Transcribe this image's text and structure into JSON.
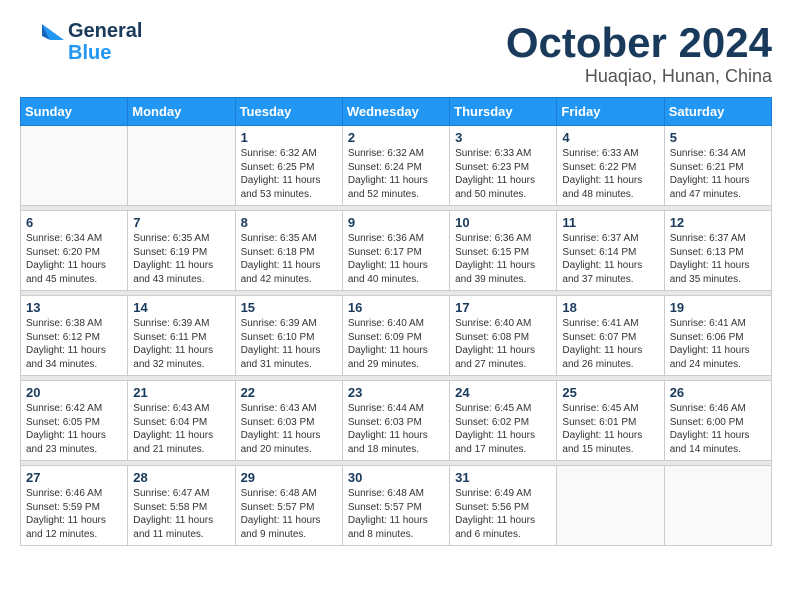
{
  "header": {
    "logo_line1": "General",
    "logo_line2": "Blue",
    "month": "October 2024",
    "location": "Huaqiao, Hunan, China"
  },
  "weekdays": [
    "Sunday",
    "Monday",
    "Tuesday",
    "Wednesday",
    "Thursday",
    "Friday",
    "Saturday"
  ],
  "weeks": [
    [
      {
        "day": "",
        "sunrise": "",
        "sunset": "",
        "daylight": ""
      },
      {
        "day": "",
        "sunrise": "",
        "sunset": "",
        "daylight": ""
      },
      {
        "day": "1",
        "sunrise": "Sunrise: 6:32 AM",
        "sunset": "Sunset: 6:25 PM",
        "daylight": "Daylight: 11 hours and 53 minutes."
      },
      {
        "day": "2",
        "sunrise": "Sunrise: 6:32 AM",
        "sunset": "Sunset: 6:24 PM",
        "daylight": "Daylight: 11 hours and 52 minutes."
      },
      {
        "day": "3",
        "sunrise": "Sunrise: 6:33 AM",
        "sunset": "Sunset: 6:23 PM",
        "daylight": "Daylight: 11 hours and 50 minutes."
      },
      {
        "day": "4",
        "sunrise": "Sunrise: 6:33 AM",
        "sunset": "Sunset: 6:22 PM",
        "daylight": "Daylight: 11 hours and 48 minutes."
      },
      {
        "day": "5",
        "sunrise": "Sunrise: 6:34 AM",
        "sunset": "Sunset: 6:21 PM",
        "daylight": "Daylight: 11 hours and 47 minutes."
      }
    ],
    [
      {
        "day": "6",
        "sunrise": "Sunrise: 6:34 AM",
        "sunset": "Sunset: 6:20 PM",
        "daylight": "Daylight: 11 hours and 45 minutes."
      },
      {
        "day": "7",
        "sunrise": "Sunrise: 6:35 AM",
        "sunset": "Sunset: 6:19 PM",
        "daylight": "Daylight: 11 hours and 43 minutes."
      },
      {
        "day": "8",
        "sunrise": "Sunrise: 6:35 AM",
        "sunset": "Sunset: 6:18 PM",
        "daylight": "Daylight: 11 hours and 42 minutes."
      },
      {
        "day": "9",
        "sunrise": "Sunrise: 6:36 AM",
        "sunset": "Sunset: 6:17 PM",
        "daylight": "Daylight: 11 hours and 40 minutes."
      },
      {
        "day": "10",
        "sunrise": "Sunrise: 6:36 AM",
        "sunset": "Sunset: 6:15 PM",
        "daylight": "Daylight: 11 hours and 39 minutes."
      },
      {
        "day": "11",
        "sunrise": "Sunrise: 6:37 AM",
        "sunset": "Sunset: 6:14 PM",
        "daylight": "Daylight: 11 hours and 37 minutes."
      },
      {
        "day": "12",
        "sunrise": "Sunrise: 6:37 AM",
        "sunset": "Sunset: 6:13 PM",
        "daylight": "Daylight: 11 hours and 35 minutes."
      }
    ],
    [
      {
        "day": "13",
        "sunrise": "Sunrise: 6:38 AM",
        "sunset": "Sunset: 6:12 PM",
        "daylight": "Daylight: 11 hours and 34 minutes."
      },
      {
        "day": "14",
        "sunrise": "Sunrise: 6:39 AM",
        "sunset": "Sunset: 6:11 PM",
        "daylight": "Daylight: 11 hours and 32 minutes."
      },
      {
        "day": "15",
        "sunrise": "Sunrise: 6:39 AM",
        "sunset": "Sunset: 6:10 PM",
        "daylight": "Daylight: 11 hours and 31 minutes."
      },
      {
        "day": "16",
        "sunrise": "Sunrise: 6:40 AM",
        "sunset": "Sunset: 6:09 PM",
        "daylight": "Daylight: 11 hours and 29 minutes."
      },
      {
        "day": "17",
        "sunrise": "Sunrise: 6:40 AM",
        "sunset": "Sunset: 6:08 PM",
        "daylight": "Daylight: 11 hours and 27 minutes."
      },
      {
        "day": "18",
        "sunrise": "Sunrise: 6:41 AM",
        "sunset": "Sunset: 6:07 PM",
        "daylight": "Daylight: 11 hours and 26 minutes."
      },
      {
        "day": "19",
        "sunrise": "Sunrise: 6:41 AM",
        "sunset": "Sunset: 6:06 PM",
        "daylight": "Daylight: 11 hours and 24 minutes."
      }
    ],
    [
      {
        "day": "20",
        "sunrise": "Sunrise: 6:42 AM",
        "sunset": "Sunset: 6:05 PM",
        "daylight": "Daylight: 11 hours and 23 minutes."
      },
      {
        "day": "21",
        "sunrise": "Sunrise: 6:43 AM",
        "sunset": "Sunset: 6:04 PM",
        "daylight": "Daylight: 11 hours and 21 minutes."
      },
      {
        "day": "22",
        "sunrise": "Sunrise: 6:43 AM",
        "sunset": "Sunset: 6:03 PM",
        "daylight": "Daylight: 11 hours and 20 minutes."
      },
      {
        "day": "23",
        "sunrise": "Sunrise: 6:44 AM",
        "sunset": "Sunset: 6:03 PM",
        "daylight": "Daylight: 11 hours and 18 minutes."
      },
      {
        "day": "24",
        "sunrise": "Sunrise: 6:45 AM",
        "sunset": "Sunset: 6:02 PM",
        "daylight": "Daylight: 11 hours and 17 minutes."
      },
      {
        "day": "25",
        "sunrise": "Sunrise: 6:45 AM",
        "sunset": "Sunset: 6:01 PM",
        "daylight": "Daylight: 11 hours and 15 minutes."
      },
      {
        "day": "26",
        "sunrise": "Sunrise: 6:46 AM",
        "sunset": "Sunset: 6:00 PM",
        "daylight": "Daylight: 11 hours and 14 minutes."
      }
    ],
    [
      {
        "day": "27",
        "sunrise": "Sunrise: 6:46 AM",
        "sunset": "Sunset: 5:59 PM",
        "daylight": "Daylight: 11 hours and 12 minutes."
      },
      {
        "day": "28",
        "sunrise": "Sunrise: 6:47 AM",
        "sunset": "Sunset: 5:58 PM",
        "daylight": "Daylight: 11 hours and 11 minutes."
      },
      {
        "day": "29",
        "sunrise": "Sunrise: 6:48 AM",
        "sunset": "Sunset: 5:57 PM",
        "daylight": "Daylight: 11 hours and 9 minutes."
      },
      {
        "day": "30",
        "sunrise": "Sunrise: 6:48 AM",
        "sunset": "Sunset: 5:57 PM",
        "daylight": "Daylight: 11 hours and 8 minutes."
      },
      {
        "day": "31",
        "sunrise": "Sunrise: 6:49 AM",
        "sunset": "Sunset: 5:56 PM",
        "daylight": "Daylight: 11 hours and 6 minutes."
      },
      {
        "day": "",
        "sunrise": "",
        "sunset": "",
        "daylight": ""
      },
      {
        "day": "",
        "sunrise": "",
        "sunset": "",
        "daylight": ""
      }
    ]
  ]
}
